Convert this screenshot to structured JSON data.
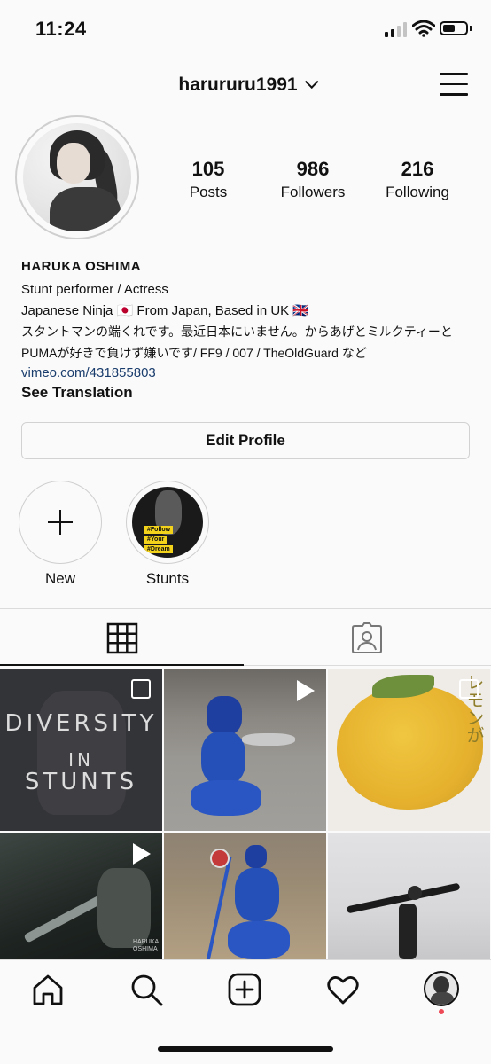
{
  "status_bar": {
    "time": "11:24"
  },
  "header": {
    "username": "harururu1991"
  },
  "profile": {
    "stats": [
      {
        "value": "105",
        "label": "Posts"
      },
      {
        "value": "986",
        "label": "Followers"
      },
      {
        "value": "216",
        "label": "Following"
      }
    ],
    "full_name": "HARUKA OSHIMA",
    "bio_lines": [
      "Stunt performer / Actress",
      "Japanese Ninja 🇯🇵 From Japan, Based in UK 🇬🇧",
      "スタントマンの端くれです。最近日本にいません。からあげとミルクティーと",
      "PUMAが好きで負けず嫌いです/ FF9 / 007 / TheOldGuard など"
    ],
    "link": "vimeo.com/431855803",
    "see_translation": "See Translation",
    "edit_profile_label": "Edit Profile"
  },
  "highlights": [
    {
      "label": "New",
      "icon": "plus-icon"
    },
    {
      "label": "Stunts",
      "tags": [
        "#Follow",
        "#Your",
        "#Dream"
      ]
    }
  ],
  "tabs": [
    {
      "name": "grid",
      "icon": "grid-icon",
      "active": true
    },
    {
      "name": "tagged",
      "icon": "tagged-icon",
      "active": false
    }
  ],
  "posts": [
    {
      "overlay": "multiple-icon",
      "text": [
        "DIVERSITY",
        "IN",
        "STUNTS"
      ]
    },
    {
      "overlay": "video-icon"
    },
    {
      "overlay": "multiple-icon"
    },
    {
      "overlay": "video-icon",
      "watermark": [
        "HARUKA",
        "OSHIMA"
      ]
    },
    {
      "overlay": null
    },
    {
      "overlay": null
    }
  ],
  "bottom_nav": [
    {
      "name": "home",
      "icon": "home-icon"
    },
    {
      "name": "search",
      "icon": "search-icon"
    },
    {
      "name": "new-post",
      "icon": "add-post-icon"
    },
    {
      "name": "activity",
      "icon": "heart-icon"
    },
    {
      "name": "profile",
      "icon": "profile-avatar"
    }
  ],
  "colors": {
    "link": "#1a3d6d",
    "notification_dot": "#ed4956",
    "highlight_tag": "#f2d21a"
  }
}
